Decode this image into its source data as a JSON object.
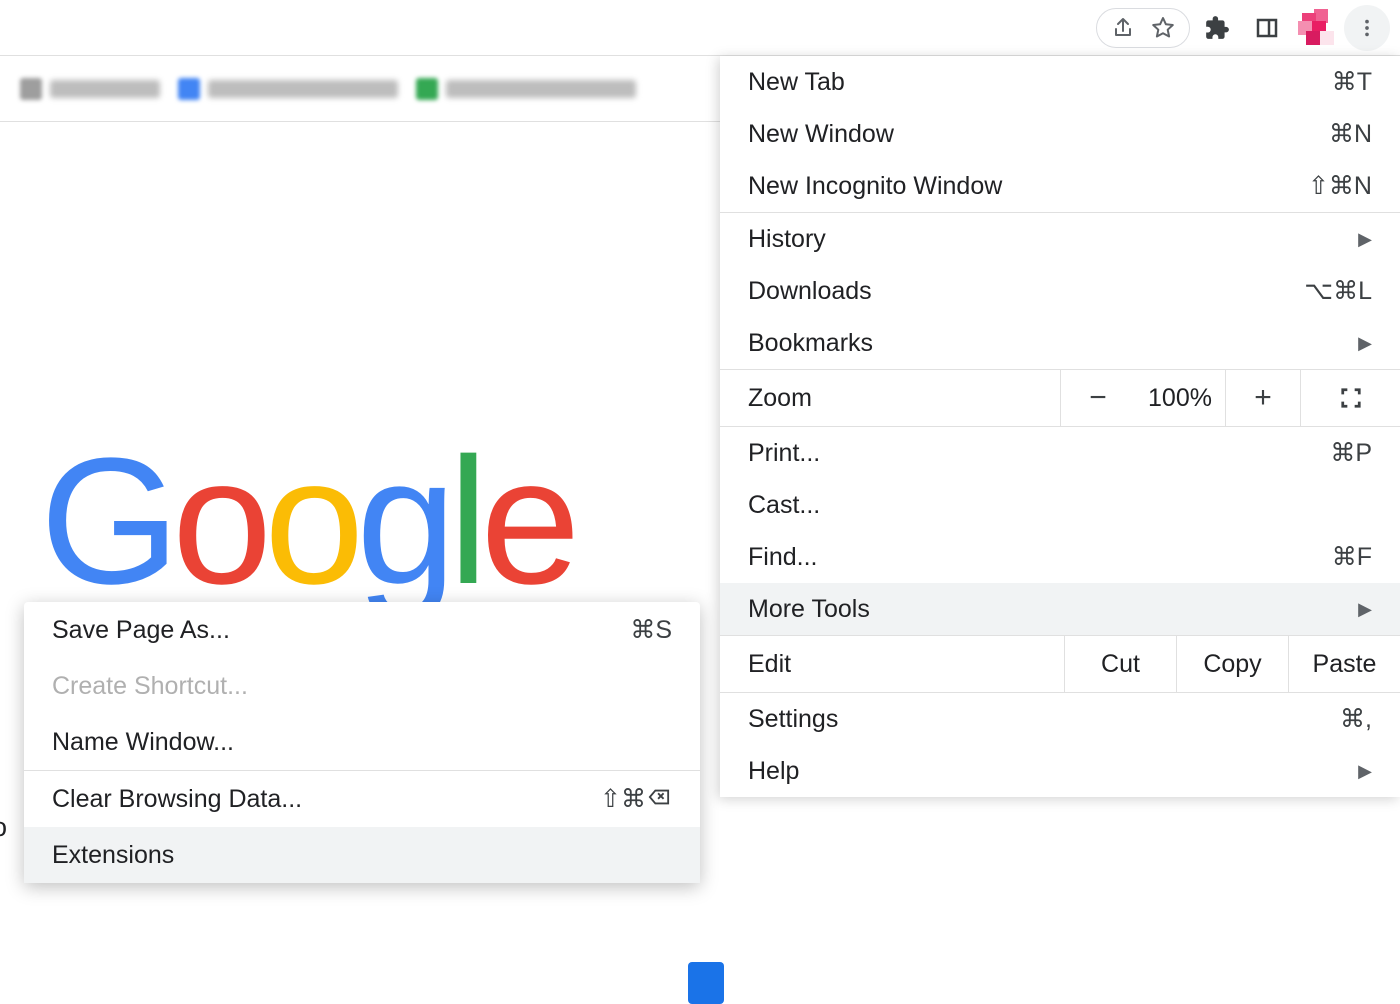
{
  "main_menu": {
    "new_tab": {
      "label": "New Tab",
      "shortcut": "⌘T"
    },
    "new_window": {
      "label": "New Window",
      "shortcut": "⌘N"
    },
    "incognito": {
      "label": "New Incognito Window",
      "shortcut": "⇧⌘N"
    },
    "history": {
      "label": "History"
    },
    "downloads": {
      "label": "Downloads",
      "shortcut": "⌥⌘L"
    },
    "bookmarks": {
      "label": "Bookmarks"
    },
    "zoom": {
      "label": "Zoom",
      "value": "100%"
    },
    "print": {
      "label": "Print...",
      "shortcut": "⌘P"
    },
    "cast": {
      "label": "Cast..."
    },
    "find": {
      "label": "Find...",
      "shortcut": "⌘F"
    },
    "more_tools": {
      "label": "More Tools"
    },
    "edit": {
      "label": "Edit",
      "cut": "Cut",
      "copy": "Copy",
      "paste": "Paste"
    },
    "settings": {
      "label": "Settings",
      "shortcut": "⌘,"
    },
    "help": {
      "label": "Help"
    }
  },
  "submenu": {
    "save_page": {
      "label": "Save Page As...",
      "shortcut": "⌘S"
    },
    "create_shortcut": {
      "label": "Create Shortcut..."
    },
    "name_window": {
      "label": "Name Window..."
    },
    "clear_data": {
      "label": "Clear Browsing Data...",
      "shortcut": "⇧⌘"
    },
    "extensions": {
      "label": "Extensions"
    }
  },
  "logo": {
    "g1": "G",
    "o1": "o",
    "o2": "o",
    "g2": "g",
    "l": "l",
    "e": "e"
  },
  "partial": "o"
}
